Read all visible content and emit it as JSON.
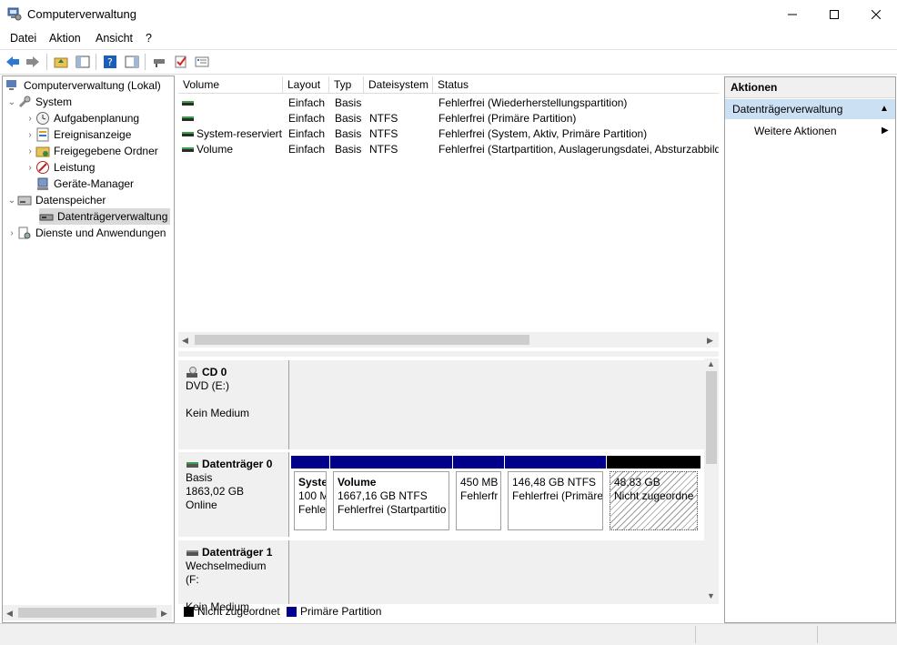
{
  "window": {
    "title": "Computerverwaltung"
  },
  "menu": [
    "Datei",
    "Aktion",
    "Ansicht",
    "?"
  ],
  "tree": {
    "root": "Computerverwaltung (Lokal)",
    "system": "System",
    "aufgaben": "Aufgabenplanung",
    "ereignis": "Ereignisanzeige",
    "freigabe": "Freigegebene Ordner",
    "leistung": "Leistung",
    "geraete": "Geräte-Manager",
    "speicher": "Datenspeicher",
    "datentraeger": "Datenträgerverwaltung",
    "dienste": "Dienste und Anwendungen"
  },
  "volumes": {
    "columns": [
      "Volume",
      "Layout",
      "Typ",
      "Dateisystem",
      "Status"
    ],
    "rows": [
      {
        "volume": "",
        "layout": "Einfach",
        "typ": "Basis",
        "fs": "",
        "status": "Fehlerfrei (Wiederherstellungspartition)"
      },
      {
        "volume": "",
        "layout": "Einfach",
        "typ": "Basis",
        "fs": "NTFS",
        "status": "Fehlerfrei (Primäre Partition)"
      },
      {
        "volume": "System-reserviert",
        "layout": "Einfach",
        "typ": "Basis",
        "fs": "NTFS",
        "status": "Fehlerfrei (System, Aktiv, Primäre Partition)"
      },
      {
        "volume": "Volume",
        "layout": "Einfach",
        "typ": "Basis",
        "fs": "NTFS",
        "status": "Fehlerfrei (Startpartition, Auslagerungsdatei, Absturzabbild"
      }
    ]
  },
  "disks": {
    "cd0": {
      "name": "CD 0",
      "type": "DVD (E:)",
      "state": "Kein Medium"
    },
    "disk0": {
      "name": "Datenträger 0",
      "type": "Basis",
      "size": "1863,02 GB",
      "state": "Online",
      "partitions": [
        {
          "l1": "Syste",
          "l2": "100 M",
          "l3": "Fehle"
        },
        {
          "l1": "Volume",
          "l2": "1667,16 GB NTFS",
          "l3": "Fehlerfrei (Startpartitio"
        },
        {
          "l1": "",
          "l2": "450 MB",
          "l3": "Fehlerfr"
        },
        {
          "l1": "",
          "l2": "146,48 GB NTFS",
          "l3": "Fehlerfrei (Primäre"
        },
        {
          "l1": "",
          "l2": "48,83 GB",
          "l3": "Nicht zugeordne"
        }
      ]
    },
    "disk1": {
      "name": "Datenträger 1",
      "type": "Wechselmedium (F:",
      "state": "Kein Medium"
    }
  },
  "legend": {
    "unallocated": "Nicht zugeordnet",
    "primary": "Primäre Partition"
  },
  "actions": {
    "header": "Aktionen",
    "section": "Datenträgerverwaltung",
    "more": "Weitere Aktionen"
  },
  "colors": {
    "primary": "#00008b",
    "unallocated": "#000000",
    "selected": "#d9d9d9",
    "action_section": "#cce0f4"
  }
}
